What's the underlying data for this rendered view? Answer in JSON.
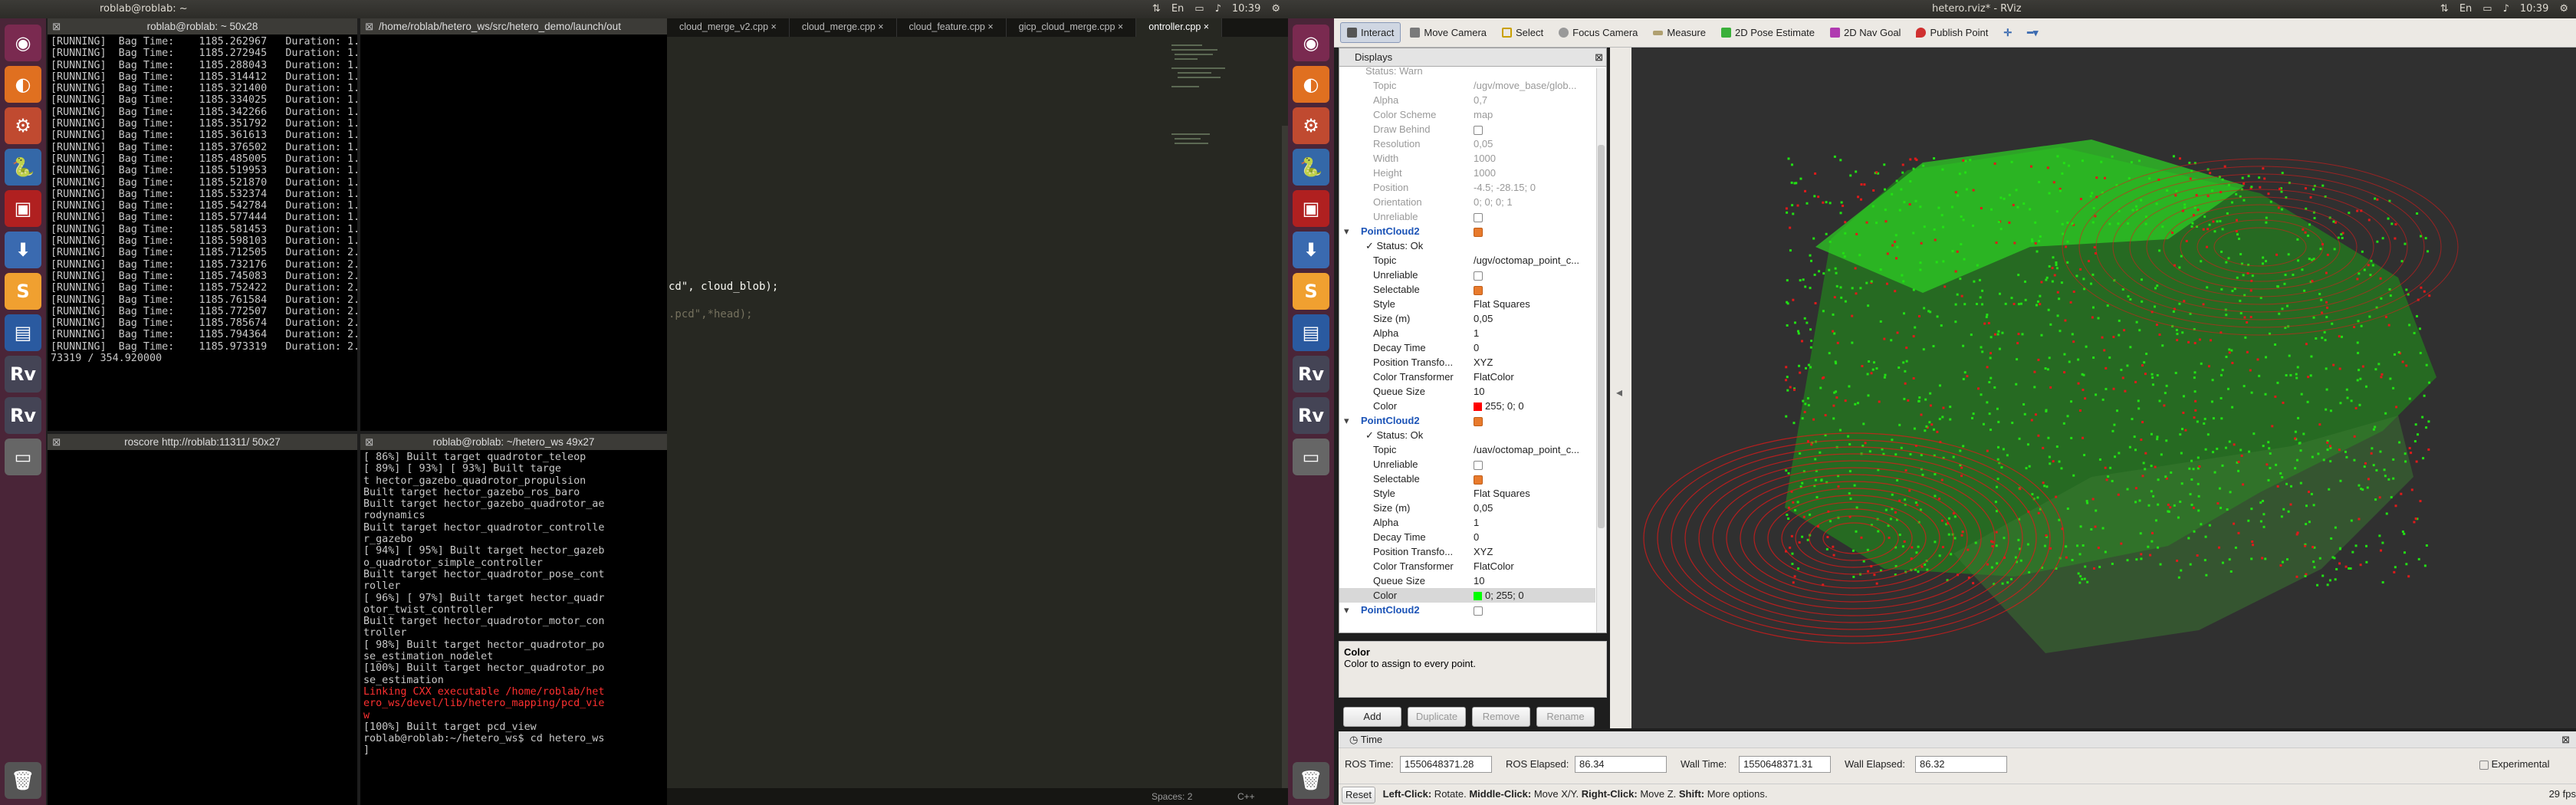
{
  "left": {
    "topbar": {
      "title": "roblab@roblab: ~",
      "clock": "10:39"
    },
    "term1": {
      "title": "roblab@roblab: ~ 50x28",
      "lines": [
        "[RUNNING]  Bag Time:    1185.262967   Duration: 1.",
        "[RUNNING]  Bag Time:    1185.272945   Duration: 1.",
        "[RUNNING]  Bag Time:    1185.288043   Duration: 1.",
        "[RUNNING]  Bag Time:    1185.314412   Duration: 1.",
        "[RUNNING]  Bag Time:    1185.321400   Duration: 1.",
        "[RUNNING]  Bag Time:    1185.334025   Duration: 1.",
        "[RUNNING]  Bag Time:    1185.342266   Duration: 1.",
        "[RUNNING]  Bag Time:    1185.351792   Duration: 1.",
        "[RUNNING]  Bag Time:    1185.361613   Duration: 1.",
        "[RUNNING]  Bag Time:    1185.376502   Duration: 1.",
        "[RUNNING]  Bag Time:    1185.485005   Duration: 1.",
        "[RUNNING]  Bag Time:    1185.519953   Duration: 1.",
        "[RUNNING]  Bag Time:    1185.521870   Duration: 1.",
        "[RUNNING]  Bag Time:    1185.532374   Duration: 1.",
        "[RUNNING]  Bag Time:    1185.542784   Duration: 1.",
        "[RUNNING]  Bag Time:    1185.577444   Duration: 1.",
        "[RUNNING]  Bag Time:    1185.581453   Duration: 1.",
        "[RUNNING]  Bag Time:    1185.598103   Duration: 1.",
        "[RUNNING]  Bag Time:    1185.712505   Duration: 2.",
        "[RUNNING]  Bag Time:    1185.732176   Duration: 2.",
        "[RUNNING]  Bag Time:    1185.745083   Duration: 2.",
        "[RUNNING]  Bag Time:    1185.752422   Duration: 2.",
        "[RUNNING]  Bag Time:    1185.761584   Duration: 2.",
        "[RUNNING]  Bag Time:    1185.772507   Duration: 2.",
        "[RUNNING]  Bag Time:    1185.785674   Duration: 2.",
        "[RUNNING]  Bag Time:    1185.794364   Duration: 2.",
        "[RUNNING]  Bag Time:    1185.973319   Duration: 2.",
        "73319 / 354.920000"
      ]
    },
    "term2": {
      "title": "/home/roblab/hetero_ws/src/hetero_demo/launch/out"
    },
    "term3": {
      "title": "roscore http://roblab:11311/ 50x27"
    },
    "term4": {
      "title": "roblab@roblab: ~/hetero_ws 49x27",
      "lines": [
        "[ 86%] Built target quadrotor_teleop",
        "[ 89%] [ 93%] [ 93%] Built targe",
        "t hector_gazebo_quadrotor_propulsion",
        "Built target hector_gazebo_ros_baro",
        "Built target hector_gazebo_quadrotor_ae",
        "rodynamics",
        "Built target hector_quadrotor_controlle",
        "r_gazebo",
        "[ 94%] [ 95%] Built target hector_gazeb",
        "o_quadrotor_simple_controller",
        "Built target hector_quadrotor_pose_cont",
        "roller",
        "[ 96%] [ 97%] Built target hector_quadr",
        "otor_twist_controller",
        "Built target hector_quadrotor_motor_con",
        "troller",
        "[ 98%] Built target hector_quadrotor_po",
        "se_estimation_nodelet",
        "[100%] Built target hector_quadrotor_po",
        "se_estimation"
      ],
      "error_lines": [
        "Linking CXX executable /home/roblab/het",
        "ero_ws/devel/lib/hetero_mapping/pcd_vie",
        "w"
      ],
      "tail_lines": [
        "[100%] Built target pcd_view",
        "roblab@roblab:~/hetero_ws$ cd hetero_ws",
        "]"
      ]
    },
    "editor": {
      "tabs": [
        "cloud_merge_v2.cpp",
        "cloud_merge.cpp",
        "cloud_feature.cpp",
        "gicp_cloud_merge.cpp",
        "ontroller.cpp"
      ],
      "line1": "cd\", cloud_blob);",
      "line2": ".pcd\",*head);",
      "status_spaces": "Spaces: 2",
      "status_lang": "C++"
    }
  },
  "right": {
    "topbar": {
      "title": "hetero.rviz* - RViz",
      "clock": "10:39"
    },
    "toolbar": {
      "interact": "Interact",
      "move_camera": "Move Camera",
      "select": "Select",
      "focus_camera": "Focus Camera",
      "measure": "Measure",
      "pose_estimate": "2D Pose Estimate",
      "nav_goal": "2D Nav Goal",
      "publish_point": "Publish Point"
    },
    "displays": {
      "title": "Displays",
      "rows": [
        {
          "k": "Status: Warn",
          "v": "",
          "type": "dis"
        },
        {
          "k": "Topic",
          "v": "/ugv/move_base/glob...",
          "type": "dis"
        },
        {
          "k": "Alpha",
          "v": "0,7",
          "type": "dis"
        },
        {
          "k": "Color Scheme",
          "v": "map",
          "type": "dis"
        },
        {
          "k": "Draw Behind",
          "v": "",
          "type": "dis"
        },
        {
          "k": "Resolution",
          "v": "0,05",
          "type": "dis"
        },
        {
          "k": "Width",
          "v": "1000",
          "type": "dis"
        },
        {
          "k": "Height",
          "v": "1000",
          "type": "dis"
        },
        {
          "k": "Position",
          "v": "-4.5; -28.15; 0",
          "type": "dis"
        },
        {
          "k": "Orientation",
          "v": "0; 0; 0; 1",
          "type": "dis"
        },
        {
          "k": "Unreliable",
          "v": "",
          "type": "dis"
        },
        {
          "k": "PointCloud2",
          "v": "",
          "type": "grp"
        },
        {
          "k": "✓ Status: Ok",
          "v": "",
          "type": "ok"
        },
        {
          "k": "Topic",
          "v": "/ugv/octomap_point_c...",
          "type": ""
        },
        {
          "k": "Unreliable",
          "v": "",
          "type": ""
        },
        {
          "k": "Selectable",
          "v": "",
          "type": ""
        },
        {
          "k": "Style",
          "v": "Flat Squares",
          "type": ""
        },
        {
          "k": "Size (m)",
          "v": "0,05",
          "type": ""
        },
        {
          "k": "Alpha",
          "v": "1",
          "type": ""
        },
        {
          "k": "Decay Time",
          "v": "0",
          "type": ""
        },
        {
          "k": "Position Transfo...",
          "v": "XYZ",
          "type": ""
        },
        {
          "k": "Color Transformer",
          "v": "FlatColor",
          "type": ""
        },
        {
          "k": "Queue Size",
          "v": "10",
          "type": ""
        },
        {
          "k": "Color",
          "v": "255; 0; 0",
          "type": ""
        },
        {
          "k": "PointCloud2",
          "v": "",
          "type": "grp"
        },
        {
          "k": "✓ Status: Ok",
          "v": "",
          "type": "ok"
        },
        {
          "k": "Topic",
          "v": "/uav/octomap_point_c...",
          "type": ""
        },
        {
          "k": "Unreliable",
          "v": "",
          "type": ""
        },
        {
          "k": "Selectable",
          "v": "",
          "type": ""
        },
        {
          "k": "Style",
          "v": "Flat Squares",
          "type": ""
        },
        {
          "k": "Size (m)",
          "v": "0,05",
          "type": ""
        },
        {
          "k": "Alpha",
          "v": "1",
          "type": ""
        },
        {
          "k": "Decay Time",
          "v": "0",
          "type": ""
        },
        {
          "k": "Position Transfo...",
          "v": "XYZ",
          "type": ""
        },
        {
          "k": "Color Transformer",
          "v": "FlatColor",
          "type": ""
        },
        {
          "k": "Queue Size",
          "v": "10",
          "type": ""
        },
        {
          "k": "Color",
          "v": "0; 255; 0",
          "type": "sel"
        },
        {
          "k": "PointCloud2",
          "v": "",
          "type": "grp"
        },
        {
          "k": "✓ Status: Ok",
          "v": "",
          "type": "dis"
        }
      ]
    },
    "description": {
      "title": "Color",
      "text": "Color to assign to every point."
    },
    "buttons": {
      "add": "Add",
      "duplicate": "Duplicate",
      "remove": "Remove",
      "rename": "Rename"
    },
    "time": {
      "title": "Time",
      "ros_time_label": "ROS Time:",
      "ros_time": "1550648371.28",
      "ros_elapsed_label": "ROS Elapsed:",
      "ros_elapsed": "86.34",
      "wall_time_label": "Wall Time:",
      "wall_time": "1550648371.31",
      "wall_elapsed_label": "Wall Elapsed:",
      "wall_elapsed": "86.32",
      "experimental": "Experimental"
    },
    "statusbar": {
      "reset": "Reset",
      "lc": "Left-Click:",
      "lc_t": " Rotate. ",
      "mc": "Middle-Click:",
      "mc_t": " Move X/Y. ",
      "rc": "Right-Click:",
      "rc_t": " Move Z. ",
      "sh": "Shift:",
      "sh_t": " More options.",
      "fps": "29 fps"
    },
    "colors": {
      "red_cloud": "#e01a1a",
      "green_cloud": "#22e014"
    }
  }
}
